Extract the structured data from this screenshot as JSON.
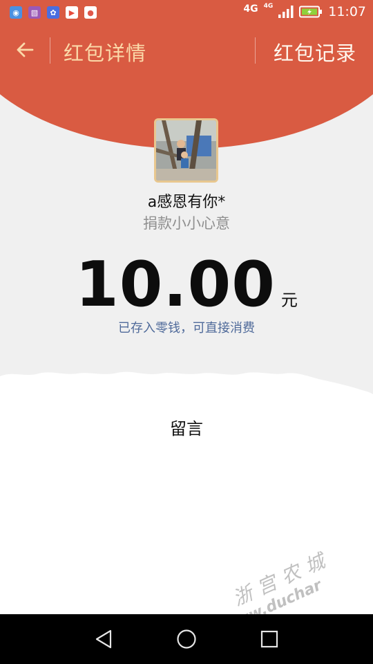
{
  "status_bar": {
    "network_primary": "4G",
    "network_secondary": "4G",
    "time": "11:07",
    "notification_icons": [
      {
        "name": "signal-app-icon",
        "color": "#4a90e2"
      },
      {
        "name": "gallery-app-icon",
        "color": "#9b59b6"
      },
      {
        "name": "paw-app-icon",
        "color": "#4a6ee0"
      },
      {
        "name": "video-app-icon",
        "color": "#e74c3c"
      },
      {
        "name": "location-app-icon",
        "color": "#e0574a"
      }
    ]
  },
  "nav": {
    "title": "红包详情",
    "right_action": "红包记录"
  },
  "sender": {
    "name": "a感恩有你*",
    "greeting": "捐款小小心意"
  },
  "amount": {
    "value": "10.00",
    "unit": "元",
    "note": "已存入零钱，可直接消费"
  },
  "message_section": {
    "title": "留言"
  },
  "watermark": {
    "text": "浙宫农城",
    "url": "www.duchar"
  },
  "colors": {
    "header": "#d95b42",
    "title_accent": "#fbd9a9",
    "link": "#4f6a9a"
  }
}
